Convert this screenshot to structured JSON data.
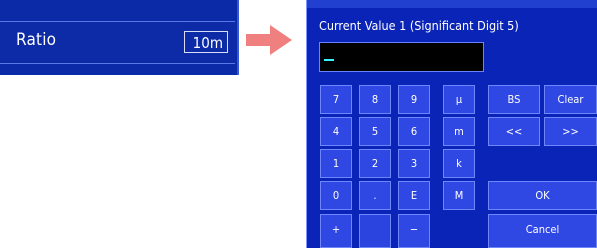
{
  "ratio_panel": {
    "label": "Ratio",
    "value": "10m"
  },
  "arrow": {
    "color": "#f08080"
  },
  "dialog": {
    "prompt": "Current Value 1 (Significant Digit 5)",
    "input_value": "",
    "keys": {
      "k7": "7",
      "k8": "8",
      "k9": "9",
      "micro": "μ",
      "k4": "4",
      "k5": "5",
      "k6": "6",
      "milli": "m",
      "k1": "1",
      "k2": "2",
      "k3": "3",
      "kilo": "k",
      "k0": "0",
      "dot": ".",
      "exp": "E",
      "mega": "M",
      "plus": "+",
      "minus": "−",
      "bs": "BS",
      "clear": "Clear",
      "left": "<<",
      "right": ">>",
      "ok": "OK",
      "cancel": "Cancel"
    }
  }
}
